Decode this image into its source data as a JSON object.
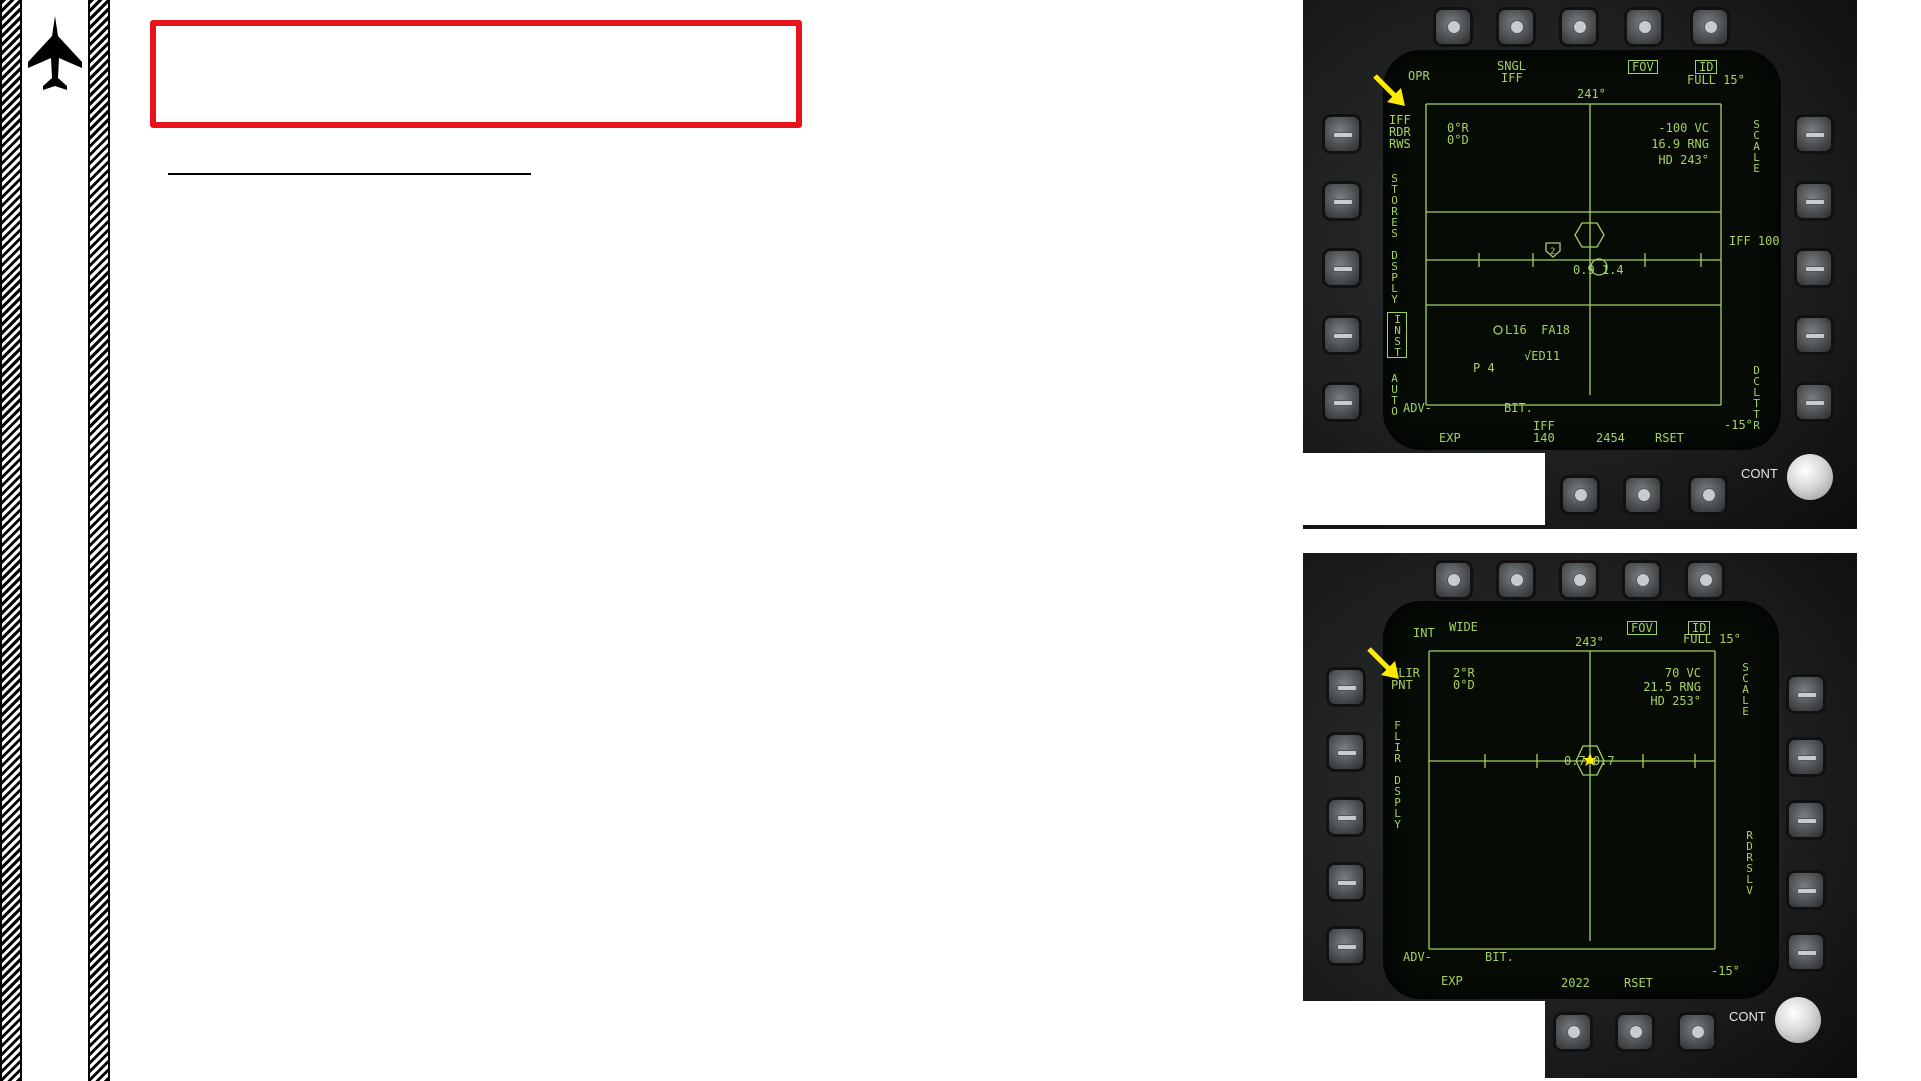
{
  "slide": {
    "title": "",
    "icon": "fighter-jet-icon"
  },
  "displays": [
    {
      "id": "top",
      "mode_top_left": "OPR",
      "sngl_iff": [
        "SNGL",
        "IFF"
      ],
      "fov_label": "FOV",
      "id_label": "ID",
      "full_label": "FULL 15°",
      "heading_tape": "241°",
      "sensor_mode_lines": [
        "IFF",
        "RDR",
        "RWS"
      ],
      "display_vert": "STORES DSPLY",
      "inst_vert": "INST",
      "auto_vert": "AUTO",
      "left_readout": [
        "0°R",
        "0°D"
      ],
      "right_readout": [
        "-100 VC",
        "16.9 RNG",
        "HD 243°"
      ],
      "scale_vert": "SCALE",
      "iff_range": "IFF 100",
      "dclttr_vert": "DCLTTR",
      "track_label": "0.9 1.4",
      "contact_number": "2",
      "l16_label": "L16  FA18",
      "ed11_label": "√ED11",
      "p4_label": "P 4",
      "adv_label": "ADV-",
      "bit_label": "BIT.",
      "bottom_row": [
        "EXP",
        "IFF\n140",
        "2454",
        "RSET"
      ],
      "elevation_label": "-15°",
      "cont_label": "CONT"
    },
    {
      "id": "bottom",
      "mode_top_left": "INT",
      "wide_label": "WIDE",
      "fov_label": "FOV",
      "id_label": "ID",
      "full_label": "FULL 15°",
      "heading_tape": "243°",
      "sensor_mode_lines": [
        "FLIR",
        "PNT"
      ],
      "display_vert": "FLIR DSPLY",
      "left_readout": [
        "2°R",
        "0°D"
      ],
      "right_readout": [
        "70 VC",
        "21.5 RNG",
        "HD 253°"
      ],
      "scale_vert": "SCALE",
      "rdr_slv_vert": "RDRSLV",
      "track_label": "0.7 0.7",
      "adv_label": "ADV-",
      "bit_label": "BIT.",
      "bottom_row": [
        "EXP",
        "2022",
        "RSET"
      ],
      "elevation_label": "-15°",
      "cont_label": "CONT"
    }
  ],
  "colors": {
    "title_border": "#e8141c",
    "mfd_symbology": "#a6d060",
    "highlight_arrow": "#ffeb00"
  }
}
